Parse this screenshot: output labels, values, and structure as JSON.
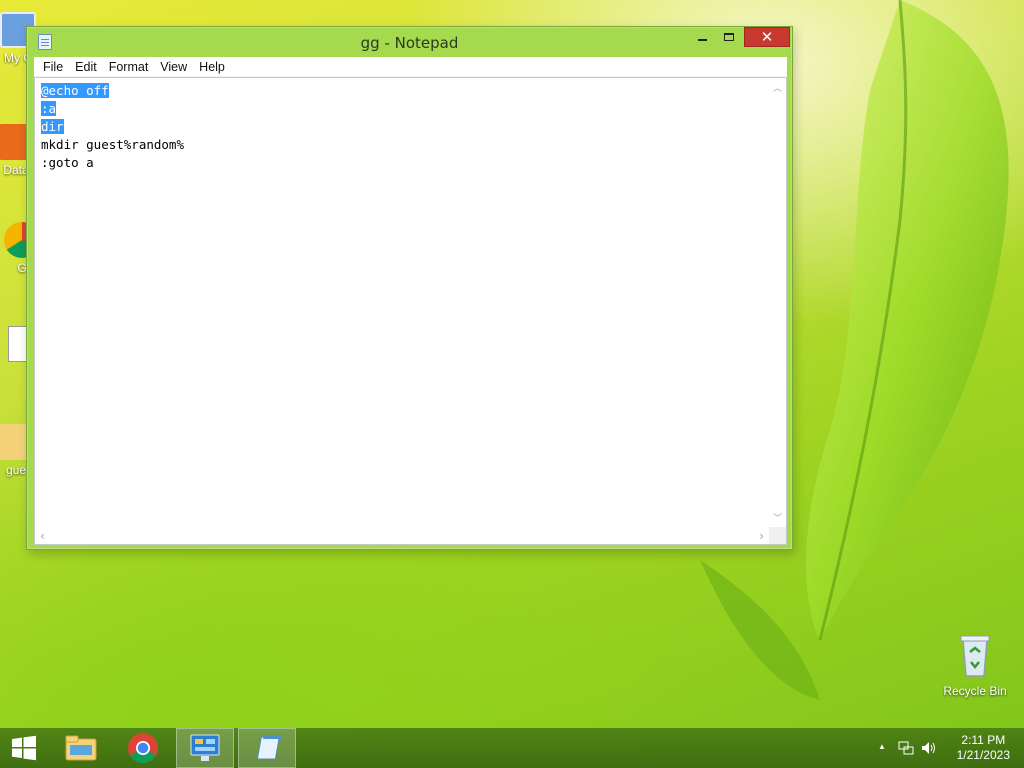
{
  "desktop": {
    "icons": [
      {
        "label": "My C"
      },
      {
        "label": "Data"
      },
      {
        "label": "G"
      },
      {
        "label": "gue"
      },
      {
        "label": "Recycle Bin"
      }
    ]
  },
  "window": {
    "title": "gg - Notepad",
    "close_glyph": "✕",
    "menu": [
      "File",
      "Edit",
      "Format",
      "View",
      "Help"
    ],
    "lines": [
      {
        "text": "@echo off",
        "selected": true
      },
      {
        "text": ":a",
        "selected": true
      },
      {
        "text": "dir",
        "selected": true
      },
      {
        "text": "mkdir guest%random%",
        "selected": false
      },
      {
        "text": ":goto a",
        "selected": false
      }
    ]
  },
  "taskbar": {
    "time": "2:11 PM",
    "date": "1/21/2023",
    "tray_up_glyph": "▲"
  },
  "colors": {
    "selection": "#3399ff",
    "close_button": "#c7392f"
  }
}
